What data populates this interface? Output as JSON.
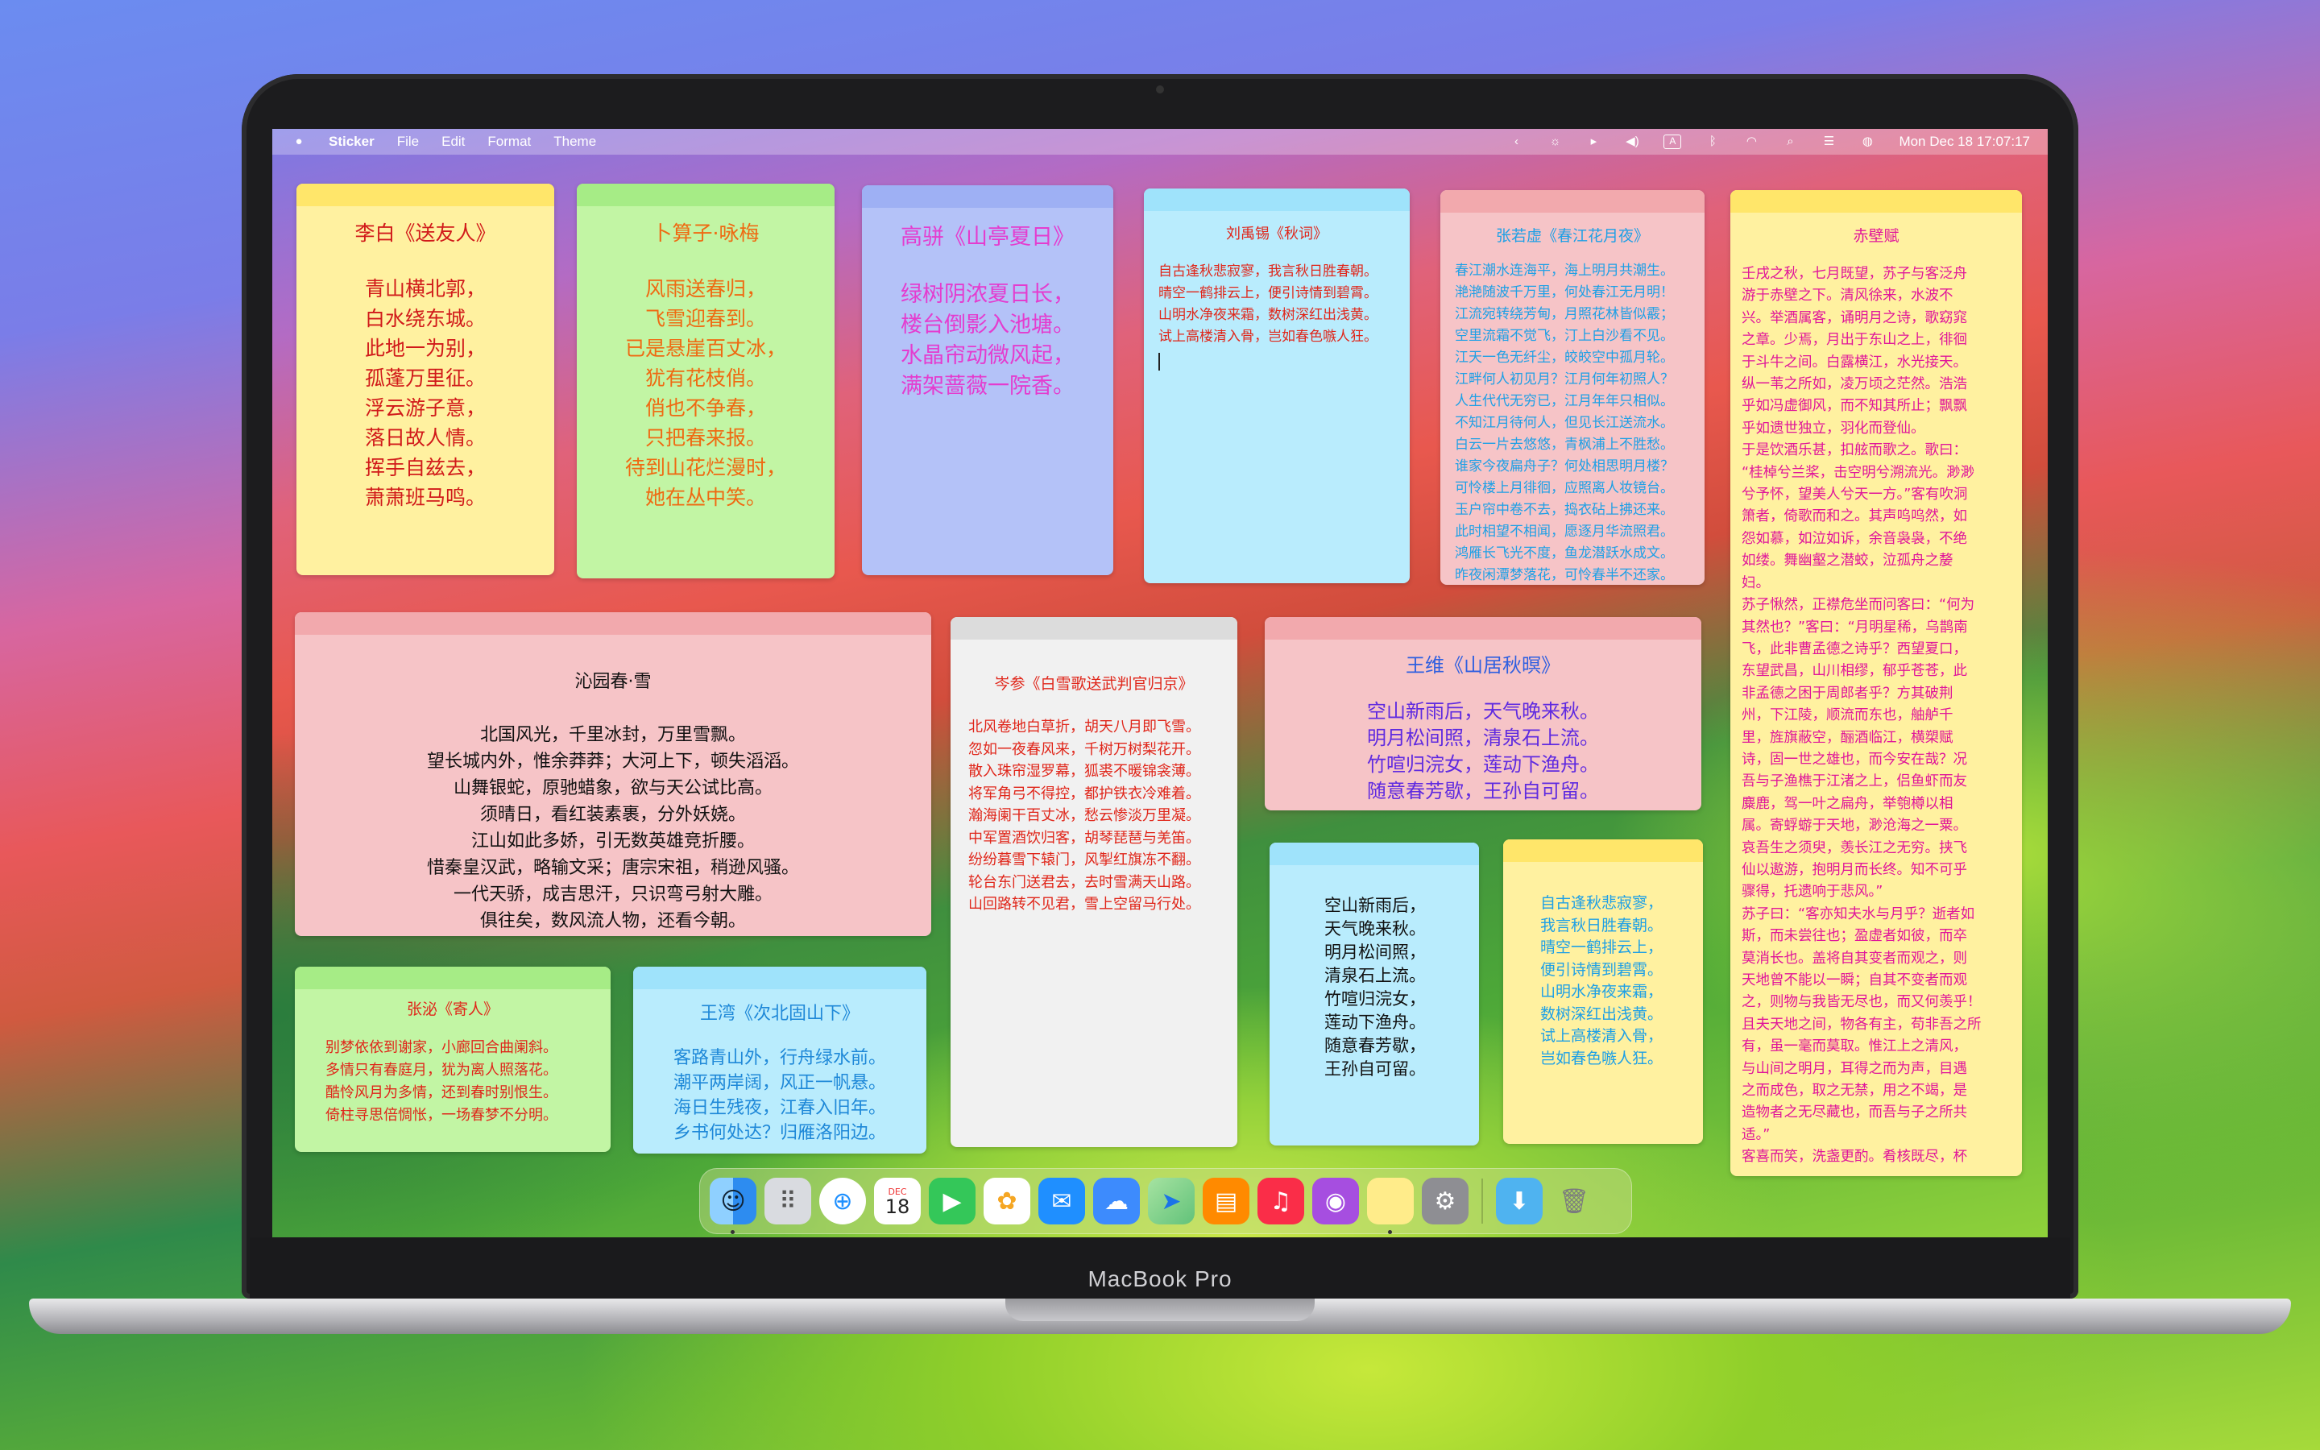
{
  "device": {
    "label": "MacBook Pro"
  },
  "menubar": {
    "app_name": "Sticker",
    "menus": [
      "File",
      "Edit",
      "Format",
      "Theme"
    ],
    "status_icons": [
      "chevron-left-icon",
      "brightness-icon",
      "play-circle-icon",
      "volume-icon",
      "keyboard-input-icon",
      "bluetooth-icon",
      "wifi-icon",
      "search-icon",
      "control-center-icon",
      "siri-icon"
    ],
    "input_label": "A",
    "clock": "Mon Dec 18  17:07:17"
  },
  "notes": {
    "n1": {
      "title": "李白《送友人》",
      "lines": [
        "青山横北郭，",
        "白水绕东城。",
        "此地一为别，",
        "孤蓬万里征。",
        "浮云游子意，",
        "落日故人情。",
        "挥手自兹去，",
        "萧萧班马鸣。"
      ]
    },
    "n2": {
      "title": "卜算子·咏梅",
      "lines": [
        "风雨送春归，",
        "飞雪迎春到。",
        "已是悬崖百丈冰，",
        "犹有花枝俏。",
        "俏也不争春，",
        "只把春来报。",
        "待到山花烂漫时，",
        "她在丛中笑。"
      ]
    },
    "n3": {
      "title": "高骈《山亭夏日》",
      "lines": [
        "绿树阴浓夏日长，",
        "楼台倒影入池塘。",
        "水晶帘动微风起，",
        "满架蔷薇一院香。"
      ]
    },
    "n4": {
      "title": "刘禹锡《秋词》",
      "lines": [
        "自古逢秋悲寂寥，我言秋日胜春朝。",
        "晴空一鹤排云上，便引诗情到碧霄。",
        "山明水净夜来霜，数树深红出浅黄。",
        "试上高楼清入骨，岂如春色嗾人狂。"
      ]
    },
    "n5": {
      "title": "张若虚《春江花月夜》",
      "lines": [
        "春江潮水连海平，海上明月共潮生。",
        "滟滟随波千万里，何处春江无月明！",
        "江流宛转绕芳甸，月照花林皆似霰；",
        "空里流霜不觉飞，汀上白沙看不见。",
        "江天一色无纤尘，皎皎空中孤月轮。",
        "江畔何人初见月？江月何年初照人？",
        "人生代代无穷已，江月年年只相似。",
        "不知江月待何人，但见长江送流水。",
        "白云一片去悠悠，青枫浦上不胜愁。",
        "谁家今夜扁舟子？何处相思明月楼？",
        "可怜楼上月徘徊，应照离人妆镜台。",
        "玉户帘中卷不去，捣衣砧上拂还来。",
        "此时相望不相闻，愿逐月华流照君。",
        "鸿雁长飞光不度，鱼龙潜跃水成文。",
        "昨夜闲潭梦落花，可怜春半不还家。"
      ]
    },
    "n6": {
      "title": "赤壁赋",
      "lines": [
        "壬戌之秋，七月既望，苏子与客泛舟",
        "游于赤壁之下。清风徐来，水波不",
        "兴。举酒属客，诵明月之诗，歌窈窕",
        "之章。少焉，月出于东山之上，徘徊",
        "于斗牛之间。白露横江，水光接天。",
        "纵一苇之所如，凌万顷之茫然。浩浩",
        "乎如冯虚御风，而不知其所止；飘飘",
        "乎如遗世独立，羽化而登仙。",
        "于是饮酒乐甚，扣舷而歌之。歌曰：",
        "“桂棹兮兰桨，击空明兮溯流光。渺渺",
        "兮予怀，望美人兮天一方。”客有吹洞",
        "箫者，倚歌而和之。其声呜呜然，如",
        "怨如慕，如泣如诉，余音袅袅，不绝",
        "如缕。舞幽壑之潜蛟，泣孤舟之嫠",
        "妇。",
        "苏子愀然，正襟危坐而问客曰：“何为",
        "其然也？”客曰：“月明星稀，乌鹊南",
        "飞，此非曹孟德之诗乎？西望夏口，",
        "东望武昌，山川相缪，郁乎苍苍，此",
        "非孟德之困于周郎者乎？方其破荆",
        "州，下江陵，顺流而东也，舳舻千",
        "里，旌旗蔽空，酾酒临江，横槊赋",
        "诗，固一世之雄也，而今安在哉？况",
        "吾与子渔樵于江渚之上，侣鱼虾而友",
        "麋鹿，驾一叶之扁舟，举匏樽以相",
        "属。寄蜉蝣于天地，渺沧海之一粟。",
        "哀吾生之须臾，羡长江之无穷。挟飞",
        "仙以遨游，抱明月而长终。知不可乎",
        "骤得，托遗响于悲风。”",
        "苏子曰：“客亦知夫水与月乎？逝者如",
        "斯，而未尝往也；盈虚者如彼，而卒",
        "莫消长也。盖将自其变者而观之，则",
        "天地曾不能以一瞬；自其不变者而观",
        "之，则物与我皆无尽也，而又何羡乎！",
        "且夫天地之间，物各有主，苟非吾之所",
        "有，虽一毫而莫取。惟江上之清风，",
        "与山间之明月，耳得之而为声，目遇",
        "之而成色，取之无禁，用之不竭，是",
        "造物者之无尽藏也，而吾与子之所共",
        "适。”",
        "客喜而笑，洗盏更酌。肴核既尽，杯"
      ]
    },
    "n7": {
      "title": "沁园春·雪",
      "lines": [
        "北国风光，千里冰封，万里雪飘。",
        "望长城内外，惟余莽莽；大河上下，顿失滔滔。",
        "山舞银蛇，原驰蜡象，欲与天公试比高。",
        "须晴日，看红装素裹，分外妖娆。",
        "江山如此多娇，引无数英雄竞折腰。",
        "惜秦皇汉武，略输文采；唐宗宋祖，稍逊风骚。",
        "一代天骄，成吉思汗，只识弯弓射大雕。",
        "俱往矣，数风流人物，还看今朝。"
      ]
    },
    "n8": {
      "title": "岑参《白雪歌送武判官归京》",
      "lines": [
        "北风卷地白草折，胡天八月即飞雪。",
        "忽如一夜春风来，千树万树梨花开。",
        "散入珠帘湿罗幕，狐裘不暖锦衾薄。",
        "将军角弓不得控，都护铁衣冷难着。",
        "瀚海阑干百丈冰，愁云惨淡万里凝。",
        "中军置酒饮归客，胡琴琵琶与羌笛。",
        "纷纷暮雪下辕门，风掣红旗冻不翻。",
        "轮台东门送君去，去时雪满天山路。",
        "山回路转不见君，雪上空留马行处。"
      ]
    },
    "n9": {
      "title": "王维《山居秋暝》",
      "lines": [
        "空山新雨后，天气晚来秋。",
        "明月松间照，清泉石上流。",
        "竹喧归浣女，莲动下渔舟。",
        "随意春芳歇，王孙自可留。"
      ]
    },
    "n10": {
      "title": "张泌《寄人》",
      "lines": [
        "别梦依依到谢家，小廊回合曲阑斜。",
        "多情只有春庭月，犹为离人照落花。",
        "酷怜风月为多情，还到春时别恨生。",
        "倚柱寻思倍惆怅，一场春梦不分明。"
      ]
    },
    "n11": {
      "title": "王湾《次北固山下》",
      "lines": [
        "客路青山外，行舟绿水前。",
        "潮平两岸阔，风正一帆悬。",
        "海日生残夜，江春入旧年。",
        "乡书何处达？归雁洛阳边。"
      ]
    },
    "n12": {
      "title": "",
      "lines": [
        "空山新雨后，",
        "天气晚来秋。",
        "明月松间照，",
        "清泉石上流。",
        "竹喧归浣女，",
        "莲动下渔舟。",
        "随意春芳歇，",
        "王孙自可留。"
      ]
    },
    "n13": {
      "title": "",
      "lines": [
        "自古逢秋悲寂寥，",
        "我言秋日胜春朝。",
        "晴空一鹤排云上，",
        "便引诗情到碧霄。",
        "山明水净夜来霜，",
        "数树深红出浅黄。",
        "试上高楼清入骨，",
        "岂如春色嗾人狂。"
      ]
    }
  },
  "dock": {
    "apps": [
      {
        "name": "finder-icon",
        "glyph": "☺",
        "color": "#2d8cf0"
      },
      {
        "name": "launchpad-icon",
        "glyph": "⠿",
        "color": "#8a8f99"
      },
      {
        "name": "safari-icon",
        "glyph": "⊕",
        "color": "#1e90ff"
      },
      {
        "name": "calendar-icon",
        "glyph": "18",
        "color": "#ffffff"
      },
      {
        "name": "facetime-icon",
        "glyph": "▶",
        "color": "#34c759"
      },
      {
        "name": "photos-icon",
        "glyph": "✿",
        "color": "#ffffff"
      },
      {
        "name": "mail-icon",
        "glyph": "✉",
        "color": "#1f8fff"
      },
      {
        "name": "weather-icon",
        "glyph": "☁",
        "color": "#3d8bfd"
      },
      {
        "name": "maps-icon",
        "glyph": "➤",
        "color": "#62c27a"
      },
      {
        "name": "books-icon",
        "glyph": "▤",
        "color": "#ff8a00"
      },
      {
        "name": "music-icon",
        "glyph": "♫",
        "color": "#fa2d48"
      },
      {
        "name": "podcasts-icon",
        "glyph": "◉",
        "color": "#a64ee0"
      },
      {
        "name": "sticker-app-icon",
        "glyph": "",
        "color": "#ffec8a"
      },
      {
        "name": "system-settings-icon",
        "glyph": "⚙",
        "color": "#8e8e93"
      },
      {
        "name": "downloads-folder-icon",
        "glyph": "⬇",
        "color": "#4fb3f0"
      },
      {
        "name": "trash-icon",
        "glyph": "🗑",
        "color": "#8a8a8e"
      }
    ],
    "calendar_month": "DEC"
  }
}
